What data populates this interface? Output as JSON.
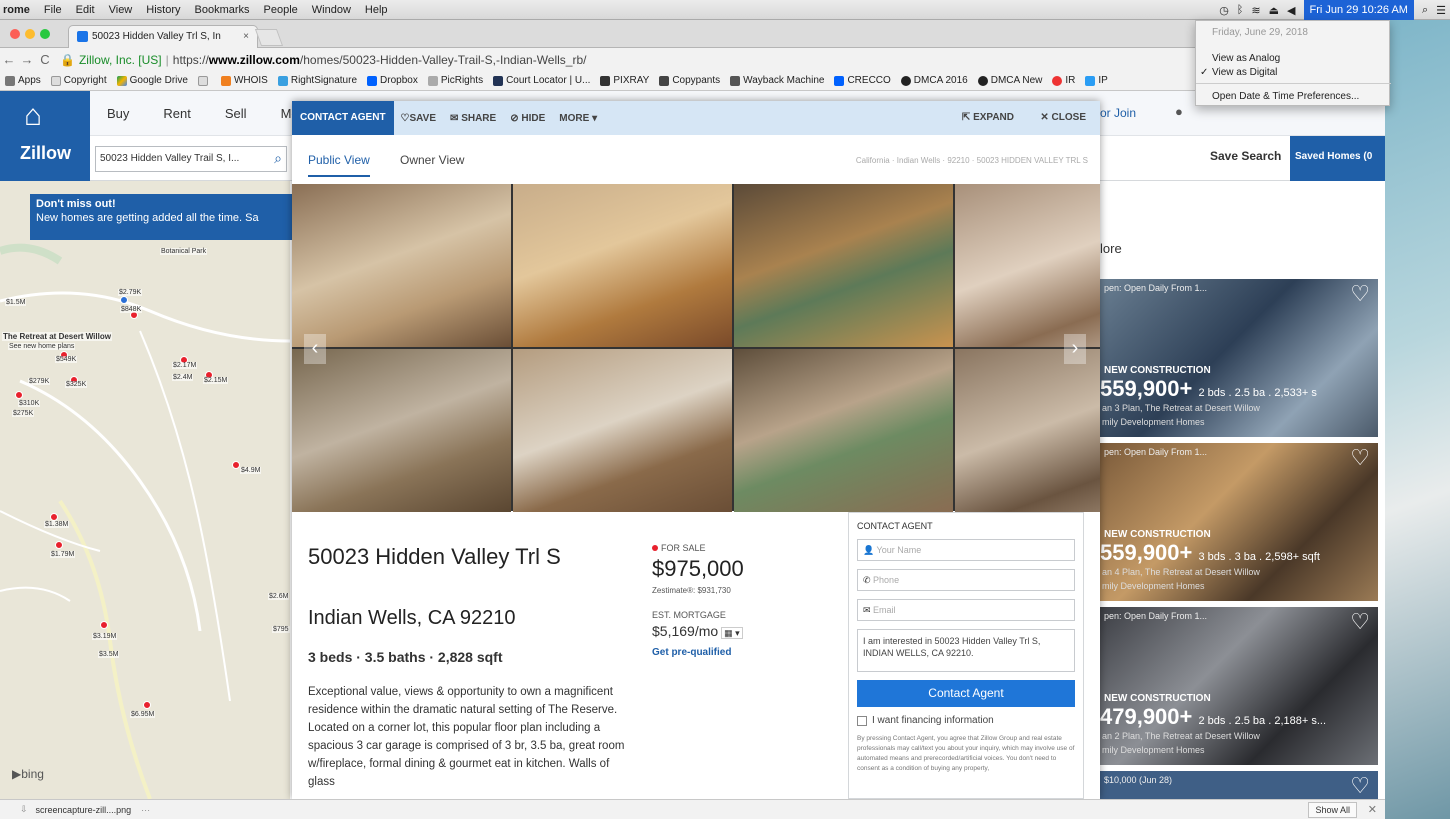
{
  "menubar": {
    "app": "rome",
    "items": [
      "File",
      "Edit",
      "View",
      "History",
      "Bookmarks",
      "People",
      "Window",
      "Help"
    ],
    "clock": "Fri Jun 29  10:26 AM"
  },
  "clock_menu": {
    "date": "Friday, June 29, 2018",
    "analog": "View as Analog",
    "digital": "View as Digital",
    "prefs": "Open Date & Time Preferences..."
  },
  "browser": {
    "tab_title": "50023 Hidden Valley Trl S, In",
    "url_org": "Zillow, Inc. [US]",
    "url_scheme": "https://",
    "url_host": "www.zillow.com",
    "url_path": "/homes/50023-Hidden-Valley-Trail-S,-Indian-Wells_rb/",
    "bookmarks": [
      "Apps",
      "Copyright",
      "Google Drive",
      "",
      "WHOIS",
      "RightSignature",
      "Dropbox",
      "PicRights",
      "Court Locator | U...",
      "PIXRAY",
      "Copypants",
      "Wayback Machine",
      "CRECCO",
      "DMCA 2016",
      "DMCA New",
      "IR",
      "IP"
    ]
  },
  "zillow": {
    "logo": "Zillow",
    "nav": [
      "Buy",
      "Rent",
      "Sell",
      "Mc"
    ],
    "join": "or Join",
    "search_value": "50023 Hidden Valley Trail S, I...",
    "save_search": "Save Search",
    "saved_homes": "Saved Homes (0",
    "banner_title": "Don't miss out!",
    "banner_text": "New homes are getting added all the time. Sa",
    "right_title": "lore",
    "bing": "bing"
  },
  "map_labels": [
    "Botanical Park",
    "$2.79K",
    "$848K",
    "$1.5M",
    "The Retreat at Desert Willow",
    "See new home plans",
    "$549K",
    "$325K",
    "$279K",
    "$310K",
    "$275K",
    "$2.17M",
    "$2.4M",
    "$2.15M",
    "$4.9M",
    "$1.38M",
    "$1.79M",
    "$2.6M",
    "$3.19M",
    "$3.5M",
    "$6.95M",
    "$795"
  ],
  "modal": {
    "contact_agent": "CONTACT AGENT",
    "save": "SAVE",
    "share": "SHARE",
    "hide": "HIDE",
    "more": "MORE",
    "expand": "EXPAND",
    "close": "CLOSE",
    "public_view": "Public View",
    "owner_view": "Owner View",
    "breadcrumb": "California · Indian Wells · 92210 · 50023 HIDDEN VALLEY TRL S",
    "address_line1": "50023 Hidden Valley Trl S",
    "address_line2": "Indian Wells, CA 92210",
    "facts": "3 beds · 3.5 baths · 2,828 sqft",
    "description": "Exceptional value, views & opportunity to own a magnificent residence within the dramatic natural setting of The Reserve. Located on a corner lot, this popular floor plan including a spacious 3 car garage is comprised of 3 br, 3.5 ba, great room w/fireplace, formal dining & gourmet eat in kitchen. Walls of glass",
    "status": "FOR SALE",
    "price": "$975,000",
    "zestimate": "Zestimate®: $931,730",
    "est_label": "EST. MORTGAGE",
    "est_value": "$5,169/mo",
    "prequal": "Get pre-qualified"
  },
  "contact_form": {
    "header": "CONTACT AGENT",
    "name_placeholder": "Your Name",
    "phone_placeholder": "Phone",
    "email_placeholder": "Email",
    "message": "I am interested in 50023 Hidden Valley Trl S, INDIAN WELLS, CA 92210.",
    "button": "Contact Agent",
    "financing": "I want financing information",
    "fine_print": "By pressing Contact Agent, you agree that Zillow Group and real estate professionals may call/text you about your inquiry, which may involve use of automated means and prerecorded/artificial voices. You don't need to consent as a condition of buying any property,"
  },
  "listing_cards": [
    {
      "open": "pen: Open Daily From 1...",
      "badge": "NEW CONSTRUCTION",
      "price": "559,900+",
      "facts": "2 bds . 2.5 ba . 2,533+ s",
      "sub1": "an 3 Plan, The Retreat at Desert Willow",
      "sub2": "mily Development Homes"
    },
    {
      "open": "pen: Open Daily From 1...",
      "badge": "NEW CONSTRUCTION",
      "price": "559,900+",
      "facts": "3 bds . 3 ba . 2,598+ sqft",
      "sub1": "an 4 Plan, The Retreat at Desert Willow",
      "sub2": "mily Development Homes"
    },
    {
      "open": "pen: Open Daily From 1...",
      "badge": "NEW CONSTRUCTION",
      "price": "479,900+",
      "facts": "2 bds . 2.5 ba . 2,188+ s...",
      "sub1": "an 2 Plan, The Retreat at Desert Willow",
      "sub2": "mily Development Homes"
    },
    {
      "open": "$10,000 (Jun 28)",
      "badge": "",
      "price": "",
      "facts": "",
      "sub1": "",
      "sub2": ""
    }
  ],
  "download": {
    "file": "screencapture-zill....png",
    "show_all": "Show All"
  },
  "colors": {
    "zillow_blue": "#1f5fa8",
    "pin_red": "#e8212d",
    "cta_blue": "#1f76d8"
  }
}
